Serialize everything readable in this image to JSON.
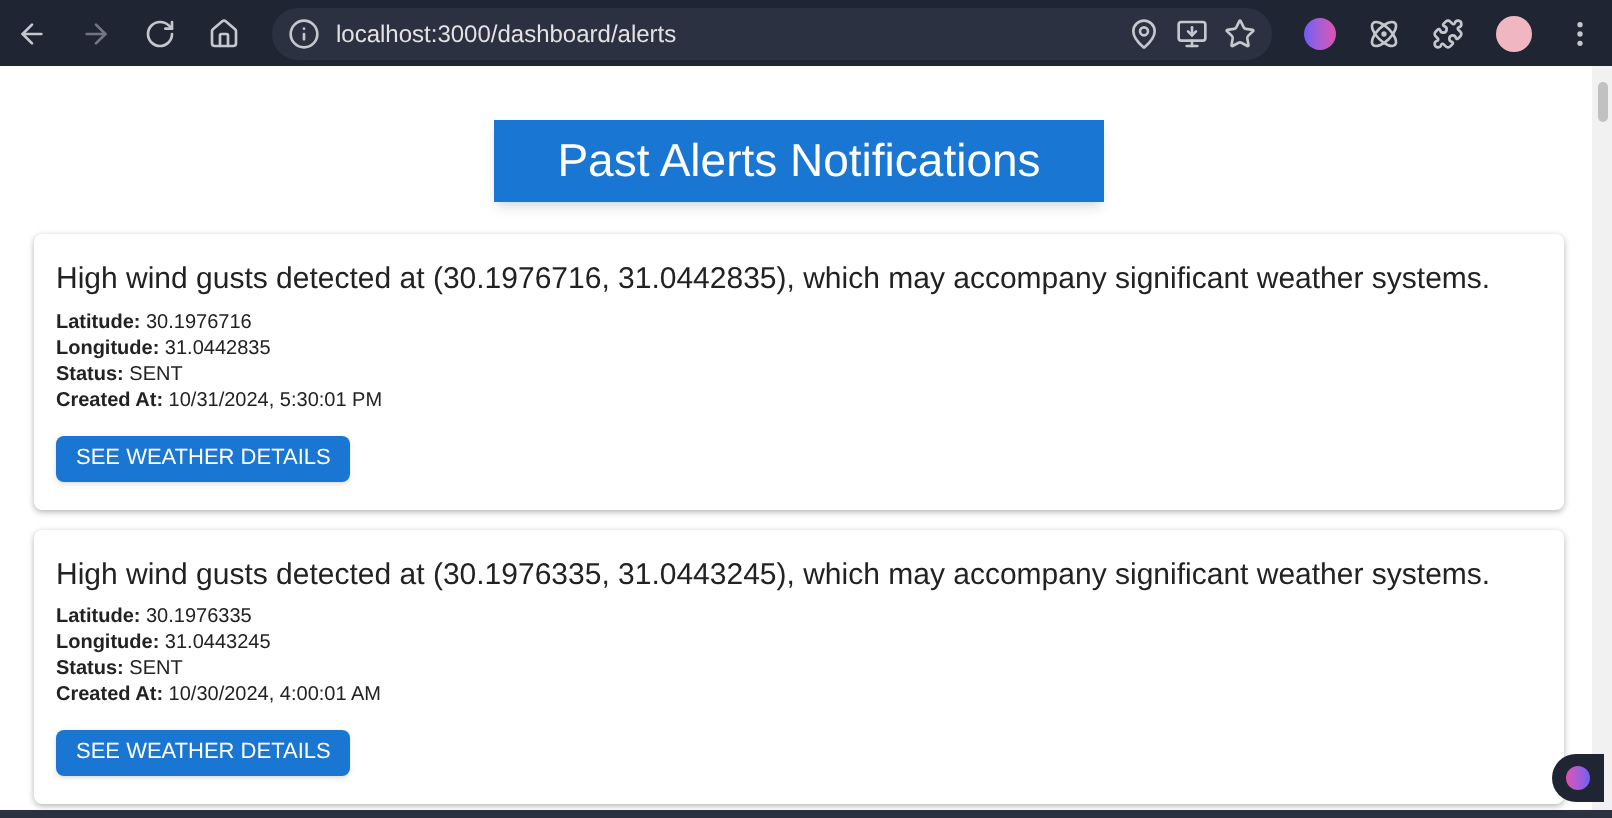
{
  "browser": {
    "url": "localhost:3000/dashboard/alerts"
  },
  "page_title": "Past Alerts Notifications",
  "alerts": [
    {
      "message": "High wind gusts detected at (30.1976716, 31.0442835), which may accompany significant weather systems.",
      "fields": [
        "**Latitude:** 30.1976716",
        "**Longitude:** 31.0442835",
        "**Status:** SENT",
        "**Created At:** 10/31/2024, 5:30:01 PM"
      ],
      "button": "SEE WEATHER DETAILS"
    },
    {
      "message": "High wind gusts detected at (30.1976335, 31.0443245), which may accompany significant weather systems.",
      "fields": [
        "**Latitude:** 30.1976335",
        "**Longitude:** 31.0443245",
        "**Status:** SENT",
        "**Created At:** 10/30/2024, 4:00:01 AM"
      ],
      "button": "SEE WEATHER DETAILS"
    }
  ]
}
